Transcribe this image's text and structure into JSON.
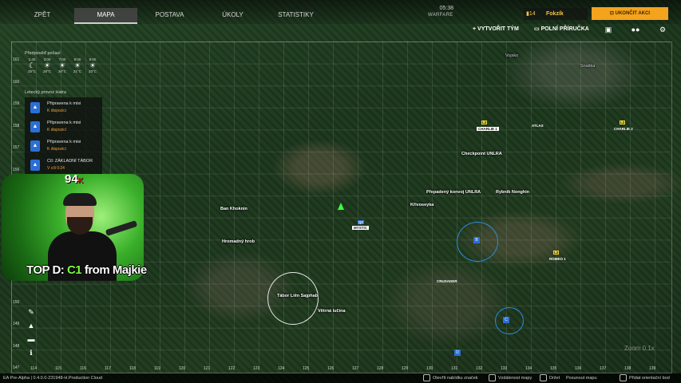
{
  "colors": {
    "accent": "#f4a31c",
    "player_name": "#f4c542",
    "mission_icon": "#2b6fd6",
    "status_orange": "#f0a43a",
    "player_marker": "#3cff3c"
  },
  "nav": {
    "back": "ZPĚT",
    "tabs": [
      {
        "label": "MAPA",
        "active": true
      },
      {
        "label": "POSTAVA",
        "active": false
      },
      {
        "label": "ÚKOLY",
        "active": false
      },
      {
        "label": "STATISTIKY",
        "active": false
      }
    ],
    "time": "05:38",
    "game_mode": "WARFARE"
  },
  "player": {
    "level": "14",
    "name": "Fokzík"
  },
  "end_button": "UKONČIT AKCI",
  "secondary": {
    "create_team": "VYTVOŘIT TÝM",
    "field_manual": "POLNÍ PŘÍRUČKA",
    "icons": [
      "chat-icon",
      "group-icon",
      "settings-icon"
    ]
  },
  "weather": {
    "label": "Předpověď počasí",
    "hours": [
      {
        "time": "1:40",
        "icon": "moon-icon",
        "glyph": "☾",
        "temp": "25°C"
      },
      {
        "time": "3:00",
        "icon": "sun-icon",
        "glyph": "☀",
        "temp": "28°C"
      },
      {
        "time": "7:00",
        "icon": "sun-icon",
        "glyph": "☀",
        "temp": "30°C"
      },
      {
        "time": "9:00",
        "icon": "sun-icon",
        "glyph": "☀",
        "temp": "31°C"
      },
      {
        "time": "9:00",
        "icon": "sun-icon",
        "glyph": "☀",
        "temp": "33°C"
      }
    ]
  },
  "missions": {
    "label": "Letecký provoz Hatra",
    "items": [
      {
        "title": "Připravena k misi",
        "status": "K dispozici"
      },
      {
        "title": "Připravena k misi",
        "status": "K dispozici"
      },
      {
        "title": "Připravena k misi",
        "status": "K dispozici"
      },
      {
        "title": "Cíl: ZÁKLADNÍ TÁBOR",
        "status": "V cíli 0:24"
      }
    ]
  },
  "stream": {
    "score_main": "94",
    "score_sub": "K",
    "caption_prefix": "TOP D: ",
    "caption_highlight": "C1",
    "caption_suffix": " from Majkie"
  },
  "map": {
    "grid_rows": [
      "161",
      "160",
      "159",
      "158",
      "157",
      "156",
      "155",
      "154",
      "153",
      "152",
      "151",
      "150",
      "149",
      "148",
      "147"
    ],
    "grid_cols": [
      "114",
      "115",
      "116",
      "117",
      "118",
      "119",
      "120",
      "121",
      "122",
      "123",
      "124",
      "125",
      "126",
      "127",
      "128",
      "129",
      "130",
      "131",
      "132",
      "133",
      "134",
      "135",
      "136",
      "137",
      "138",
      "139"
    ],
    "places": {
      "vojsko": "Vojsko",
      "snaska": "Snaška",
      "charlie1": "CHARLIE 1",
      "atlas": "ATLAS",
      "charlie2": "CHARLIE 2",
      "checkpoint": "Checkpoint UNLRA",
      "convoy": "Přepadený konvoj UNLRA",
      "fishery": "Rybník Nonghin",
      "krivosejka": "Křivoseyka",
      "ban_khoknin": "Ban Khoknin",
      "mystic": "MYSTIC",
      "mass_grave": "Hromadný hrob",
      "romeo1": "ROMEO 1",
      "crusader": "CRUSADER",
      "camp": "Tábor Liên Sajphab",
      "vetrna": "Větrná lučina"
    },
    "tags": {
      "charlie1": "L2",
      "charlie2": "L2",
      "romeo1": "L2",
      "mystic": "Q2"
    },
    "zoom": "Zoom 0.1x"
  },
  "tools": [
    "pencil-icon",
    "triangle-icon",
    "ruler-icon",
    "info-icon"
  ],
  "bottom": {
    "version": "EA Pre-Alpha | 0.4.0.0-231948-H.Production Cloud",
    "hints": [
      "Otevřít nabídku značek",
      "Vzdálenost mapy",
      "Držet",
      "Posunout mapu",
      "Přidat orientační bod"
    ]
  }
}
